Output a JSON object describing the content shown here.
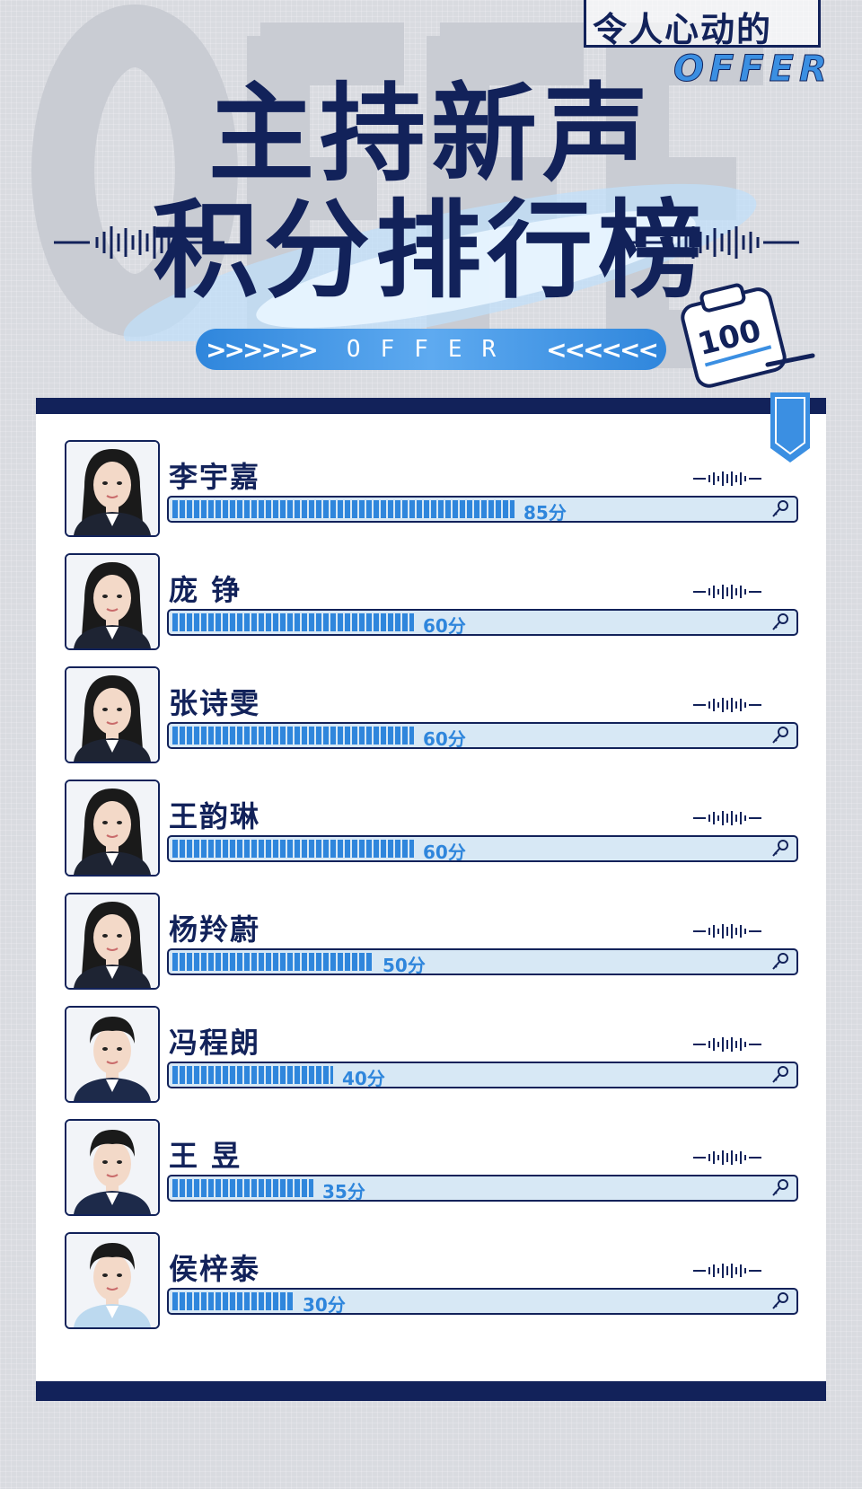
{
  "header": {
    "show_title": "令人心动的",
    "show_logo": "OFFER",
    "title_line1": "主持新声",
    "title_line2": "积分排行榜",
    "badge": "100",
    "pill_text": "OFFER",
    "pill_left": ">>>>>>",
    "pill_right": "<<<<<<"
  },
  "colors": {
    "navy": "#12225a",
    "blue": "#2f86dc",
    "track": "#d7e8f5"
  },
  "ranking": [
    {
      "name": "李宇嘉",
      "score": 85,
      "score_label": "85分",
      "gender": "f"
    },
    {
      "name": "庞 铮",
      "score": 60,
      "score_label": "60分",
      "gender": "f"
    },
    {
      "name": "张诗雯",
      "score": 60,
      "score_label": "60分",
      "gender": "f"
    },
    {
      "name": "王韵琳",
      "score": 60,
      "score_label": "60分",
      "gender": "f"
    },
    {
      "name": "杨羚蔚",
      "score": 50,
      "score_label": "50分",
      "gender": "f"
    },
    {
      "name": "冯程朗",
      "score": 40,
      "score_label": "40分",
      "gender": "m"
    },
    {
      "name": "王 昱",
      "score": 35,
      "score_label": "35分",
      "gender": "m"
    },
    {
      "name": "侯梓泰",
      "score": 30,
      "score_label": "30分",
      "gender": "m"
    }
  ]
}
